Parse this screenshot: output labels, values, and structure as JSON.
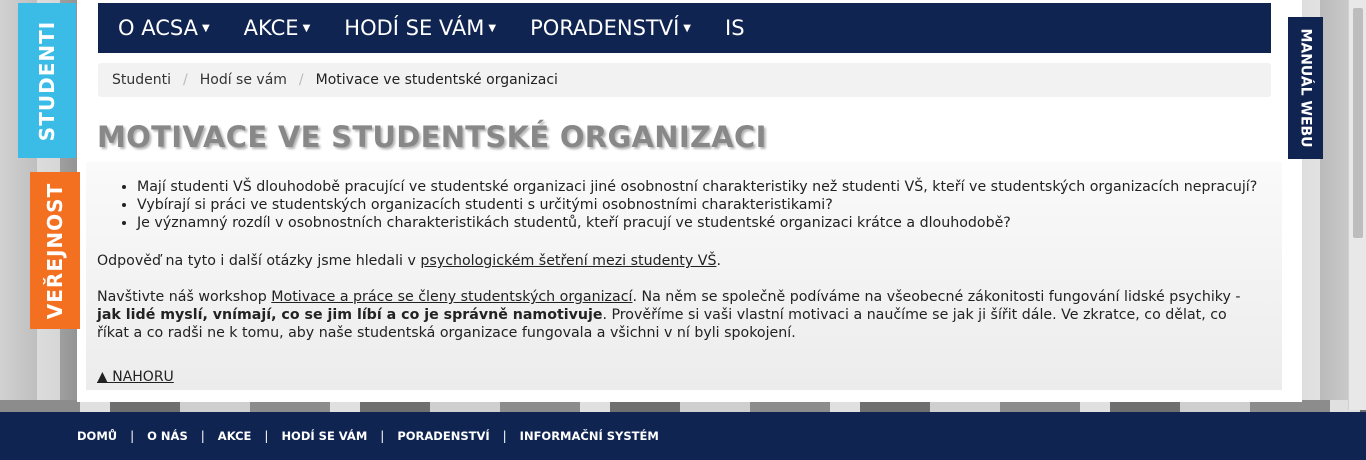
{
  "side_tabs": {
    "studenti": "STUDENTI",
    "verejnost": "VEŘEJNOST",
    "manual": "MANUÁL WEBU"
  },
  "nav": {
    "items": [
      {
        "label": "O ACSA",
        "dropdown": true
      },
      {
        "label": "AKCE",
        "dropdown": true
      },
      {
        "label": "HODÍ SE VÁM",
        "dropdown": true
      },
      {
        "label": "PORADENSTVÍ",
        "dropdown": true
      },
      {
        "label": "IS",
        "dropdown": false
      }
    ]
  },
  "breadcrumb": {
    "items": [
      "Studenti",
      "Hodí se vám",
      "Motivace ve studentské organizaci"
    ],
    "separator": "/"
  },
  "page": {
    "title": "MOTIVACE VE STUDENTSKÉ ORGANIZACI",
    "questions": [
      "Mají studenti VŠ dlouhodobě pracující ve studentské organizaci jiné osobnostní charakteristiky než studenti VŠ, kteří ve studentských organizacích nepracují?",
      "Vybírají si práci ve studentských organizacích studenti s určitými osobnostními charakteristikami?",
      "Je významný rozdíl v osobnostních charakteristikách studentů, kteří pracují ve studentské organizaci krátce a dlouhodobě?"
    ],
    "p1_text": "Odpověď na tyto i další otázky jsme hledali v ",
    "p1_link": "psychologickém šetření mezi studenty VŠ",
    "p1_end": ".",
    "p2_text1": "Navštivte náš workshop ",
    "p2_link": "Motivace a práce se členy studentských organizací",
    "p2_text2": ". Na něm se společně podíváme na všeobecné zákonitosti fungování lidské psychiky - ",
    "p2_bold": "jak lidé myslí, vnímají, co se jim líbí a co je správně namotivuje",
    "p2_text3": ". Prověříme si vaši vlastní motivaci a naučíme se jak ji šířit dále. Ve zkratce, co dělat, co říkat a co radši ne k tomu, aby naše studentská organizace fungovala a všichni v ní byli spokojení.",
    "back_to_top": "▲ NAHORU"
  },
  "footer": {
    "links": [
      "DOMŮ",
      "O NÁS",
      "AKCE",
      "HODÍ SE VÁM",
      "PORADENSTVÍ",
      "INFORMAČNÍ SYSTÉM"
    ],
    "separator": "|"
  },
  "colors": {
    "navy": "#0f2451",
    "studenti_tab": "#3bbce6",
    "verejnost_tab": "#f37021",
    "title_gray": "#888888"
  }
}
